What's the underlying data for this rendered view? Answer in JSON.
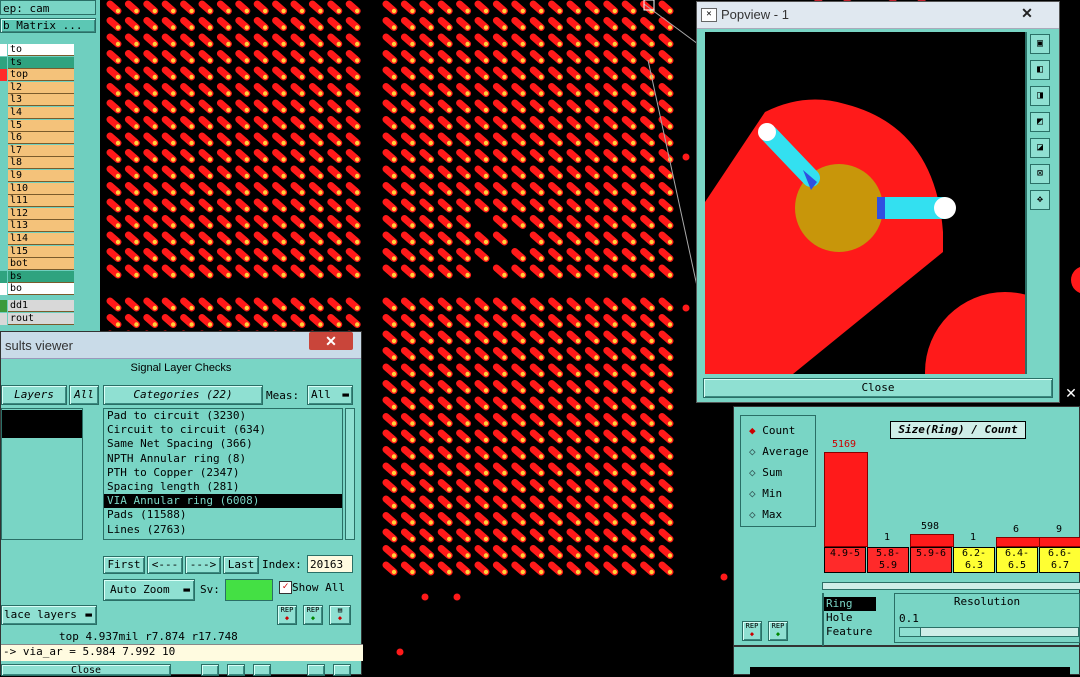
{
  "sidebar": {
    "step_label": "ep: cam",
    "matrix_button": "b Matrix ...",
    "layers": [
      {
        "name": "to",
        "bg": "#ffffff",
        "marker": "#ffffff"
      },
      {
        "name": "ts",
        "bg": "#2fa37f",
        "marker": "#2fa37f"
      },
      {
        "name": "top",
        "bg": "#f4c27a",
        "marker": "#ff2a2a"
      },
      {
        "name": "l2",
        "bg": "#f4c27a",
        "marker": "#6fcfbf"
      },
      {
        "name": "l3",
        "bg": "#f4c27a",
        "marker": "#6fcfbf"
      },
      {
        "name": "l4",
        "bg": "#f4c27a",
        "marker": "#6fcfbf"
      },
      {
        "name": "l5",
        "bg": "#f4c27a",
        "marker": "#6fcfbf"
      },
      {
        "name": "l6",
        "bg": "#f4c27a",
        "marker": "#6fcfbf"
      },
      {
        "name": "l7",
        "bg": "#f4c27a",
        "marker": "#6fcfbf"
      },
      {
        "name": "l8",
        "bg": "#f4c27a",
        "marker": "#6fcfbf"
      },
      {
        "name": "l9",
        "bg": "#f4c27a",
        "marker": "#6fcfbf"
      },
      {
        "name": "l10",
        "bg": "#f4c27a",
        "marker": "#6fcfbf"
      },
      {
        "name": "l11",
        "bg": "#f4c27a",
        "marker": "#6fcfbf"
      },
      {
        "name": "l12",
        "bg": "#f4c27a",
        "marker": "#6fcfbf"
      },
      {
        "name": "l13",
        "bg": "#f4c27a",
        "marker": "#6fcfbf"
      },
      {
        "name": "l14",
        "bg": "#f4c27a",
        "marker": "#6fcfbf"
      },
      {
        "name": "l15",
        "bg": "#f4c27a",
        "marker": "#6fcfbf"
      },
      {
        "name": "bot",
        "bg": "#f4c27a",
        "marker": "#6fcfbf"
      },
      {
        "name": "bs",
        "bg": "#2fa37f",
        "marker": "#2fa37f"
      },
      {
        "name": "bo",
        "bg": "#ffffff",
        "marker": "#ffffff"
      }
    ],
    "extra_layers": [
      {
        "name": "dd1",
        "bg": "#d8d8d8",
        "marker": "#3c9a3c"
      },
      {
        "name": "rout",
        "bg": "#d8d8d8",
        "marker": "#d8d8d8"
      }
    ]
  },
  "results_viewer": {
    "window_title": "sults viewer",
    "close_x": "✕",
    "panel_title": "Signal Layer Checks",
    "layers_btn": "Layers",
    "all_btn": "All",
    "categories_btn": "Categories (22)",
    "meas_label": "Meas:",
    "meas_value": "All",
    "categories": [
      "Pad to circuit (3230)",
      "Circuit to circuit (634)",
      "Same Net Spacing (366)",
      "NPTH Annular ring (8)",
      "PTH to Copper (2347)",
      "Spacing length (281)",
      "VIA Annular ring (6008)",
      "Pads (11588)",
      "Lines (2763)"
    ],
    "selected_index": 6,
    "first_btn": "First",
    "prev_btn": "<---",
    "next_btn": "--->",
    "last_btn": "Last",
    "index_label": "Index:",
    "index_value": "20163",
    "auto_zoom_btn": "Auto Zoom",
    "sv_label": "Sv:",
    "show_all_label": "Show All",
    "replace_layers_btn": "lace layers",
    "status_top": "top 4.937mil  r7.874  r17.748",
    "status_via": "-> via_ar = 5.984 7.992 10",
    "close_btn": "Close"
  },
  "popview": {
    "title": "Popview - 1",
    "close_x": "✕",
    "close_btn": "Close",
    "tools": [
      "tool-1",
      "tool-2",
      "tool-3",
      "tool-4",
      "tool-5",
      "tool-6",
      "tool-7"
    ]
  },
  "histogram": {
    "radios": [
      "Count",
      "Average",
      "Sum",
      "Min",
      "Max"
    ],
    "selected_radio": 0,
    "title": "Size(Ring) / Count",
    "bins": [
      "4.9-5",
      "5.8-5.9",
      "5.9-6",
      "6.2-6.3",
      "6.4-6.5",
      "6.6-6.7"
    ],
    "bin_colors": [
      "#ff2a2a",
      "#ff2a2a",
      "#ff2a2a",
      "#ffff33",
      "#ffff33",
      "#ffff33"
    ],
    "counts": [
      5169,
      1,
      598,
      1,
      6,
      9
    ],
    "resolution_label": "Resolution",
    "resolution_value": "0.1",
    "options": [
      "Ring",
      "Hole",
      "Feature"
    ],
    "selected_option": 0
  },
  "colors": {
    "copper": "#ff1a1a",
    "panel": "#79d5c5",
    "pad_center": "#c8960a",
    "trace": "#33e0f0"
  }
}
